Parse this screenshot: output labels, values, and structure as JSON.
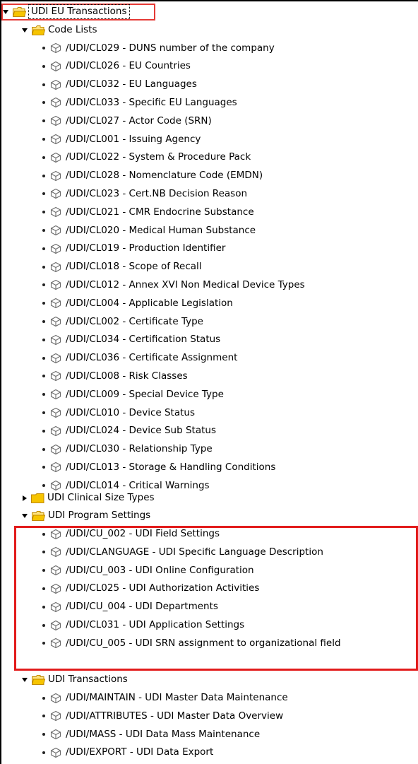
{
  "tree": {
    "root": {
      "label": "UDI EU Transactions"
    },
    "code_lists": {
      "label": "Code Lists",
      "items": [
        "/UDI/CL029 - DUNS number of the company",
        "/UDI/CL026 - EU Countries",
        "/UDI/CL032 - EU Languages",
        "/UDI/CL033 - Specific EU Languages",
        "/UDI/CL027 - Actor Code (SRN)",
        "/UDI/CL001 - Issuing Agency",
        "/UDI/CL022 - System & Procedure Pack",
        "/UDI/CL028 - Nomenclature Code (EMDN)",
        "/UDI/CL023 - Cert.NB Decision Reason",
        "/UDI/CL021 - CMR Endocrine Substance",
        "/UDI/CL020 - Medical Human Substance",
        "/UDI/CL019 - Production Identifier",
        "/UDI/CL018 - Scope of Recall",
        "/UDI/CL012 - Annex XVI Non Medical Device Types",
        "/UDI/CL004 - Applicable Legislation",
        "/UDI/CL002 - Certificate Type",
        "/UDI/CL034 - Certification Status",
        "/UDI/CL036 - Certificate Assignment",
        "/UDI/CL008 - Risk Classes",
        "/UDI/CL009 - Special Device Type",
        "/UDI/CL010 - Device Status",
        "/UDI/CL024 - Device Sub Status",
        "/UDI/CL030 - Relationship Type",
        "/UDI/CL013 - Storage & Handling Conditions",
        "/UDI/CL014 - Critical Warnings"
      ],
      "subfolder": "UDI Clinical Size Types"
    },
    "program_settings": {
      "label": "UDI Program Settings",
      "items": [
        "/UDI/CU_002 - UDI Field Settings",
        "/UDI/CLANGUAGE - UDI Specific Language Description",
        "/UDI/CU_003 - UDI Online Configuration",
        "/UDI/CL025 - UDI Authorization Activities",
        "/UDI/CU_004 - UDI Departments",
        "/UDI/CL031 - UDI Application Settings",
        "/UDI/CU_005 - UDI SRN assignment to organizational field"
      ]
    },
    "transactions": {
      "label": "UDI Transactions",
      "items": [
        "/UDI/MAINTAIN - UDI Master Data Maintenance",
        "/UDI/ATTRIBUTES - UDI Master Data Overview",
        "/UDI/MASS - UDI Data Mass Maintenance",
        "/UDI/EXPORT - UDI Data Export"
      ]
    }
  },
  "colors": {
    "folder": "#f2c200",
    "highlight_border": "#e21b1b",
    "object_icon": "#6b6b6b"
  },
  "icons": {
    "folder": "folder-icon",
    "object": "object-cube-icon",
    "expanded": "caret-down-icon",
    "collapsed": "caret-right-icon"
  }
}
